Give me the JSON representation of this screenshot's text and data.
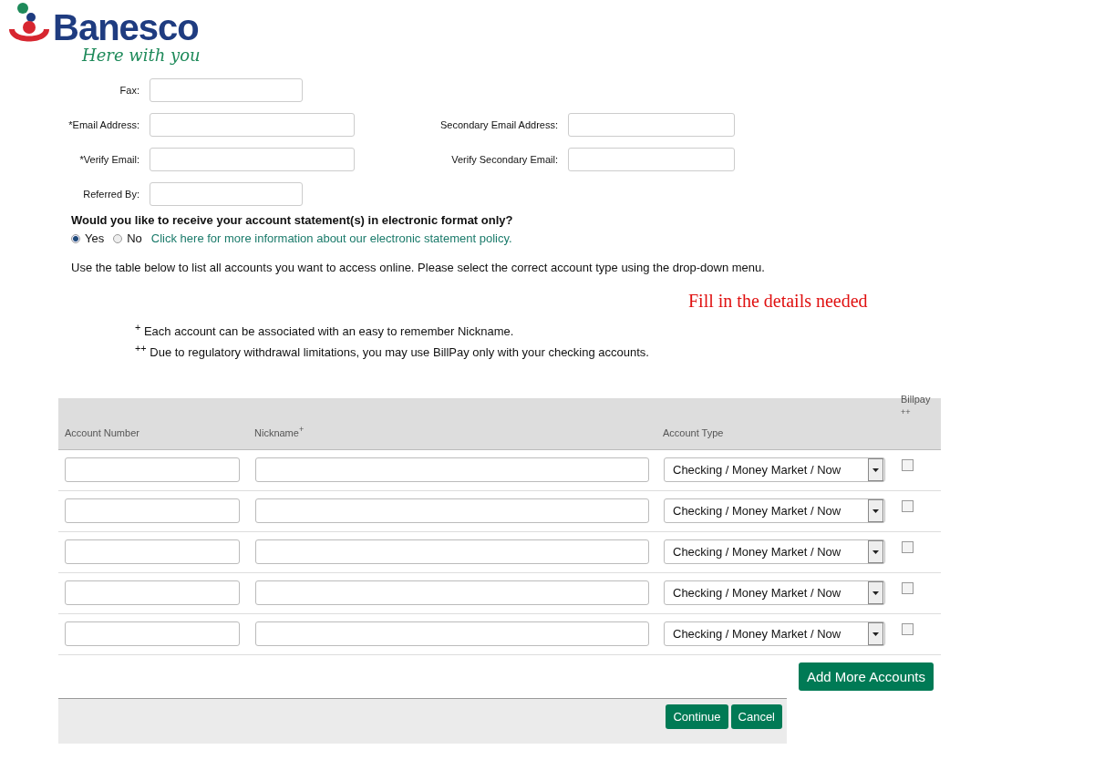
{
  "logo": {
    "name": "Banesco",
    "tagline": "Here with you"
  },
  "contact_fields": [
    {
      "left": {
        "label": "Fax:"
      }
    },
    {
      "left": {
        "label": "*Email Address:"
      },
      "right": {
        "label": "Secondary Email Address:"
      }
    },
    {
      "left": {
        "label": "*Verify Email:"
      },
      "right": {
        "label": "Verify Secondary Email:"
      }
    },
    {
      "left": {
        "label": "Referred By:"
      }
    }
  ],
  "statement_question": "Would you like to receive your account statement(s) in electronic format only?",
  "statement_options": [
    {
      "label": "Yes",
      "selected": true
    },
    {
      "label": "No",
      "selected": false
    }
  ],
  "policy_link": "Click here for more information about our electronic statement policy.",
  "instructions": "Use the table below to list all accounts you want to access online. Please select the correct account type using the drop-down menu.",
  "annotation": "Fill in the details needed",
  "footnotes": [
    "$^{+}$ Each account can be associated with an easy to remember Nickname.",
    "$^{++}$ Due to regulatory withdrawal limitations, you may use BillPay only with your checking accounts."
  ],
  "table": {
    "columns": [
      "Account Number",
      "Nickname$^{+}$",
      "Account Type",
      "Billpay"
    ],
    "billpay_mark": "++",
    "rows": [
      {
        "account_type": "Checking / Money Market / Now",
        "billpay": false
      },
      {
        "account_type": "Checking / Money Market / Now",
        "billpay": false
      },
      {
        "account_type": "Checking / Money Market / Now",
        "billpay": false
      },
      {
        "account_type": "Checking / Money Market / Now",
        "billpay": false
      },
      {
        "account_type": "Checking / Money Market / Now",
        "billpay": false
      }
    ]
  },
  "add_button": "Add More Accounts",
  "footer_buttons": [
    "Continue",
    "Cancel"
  ]
}
